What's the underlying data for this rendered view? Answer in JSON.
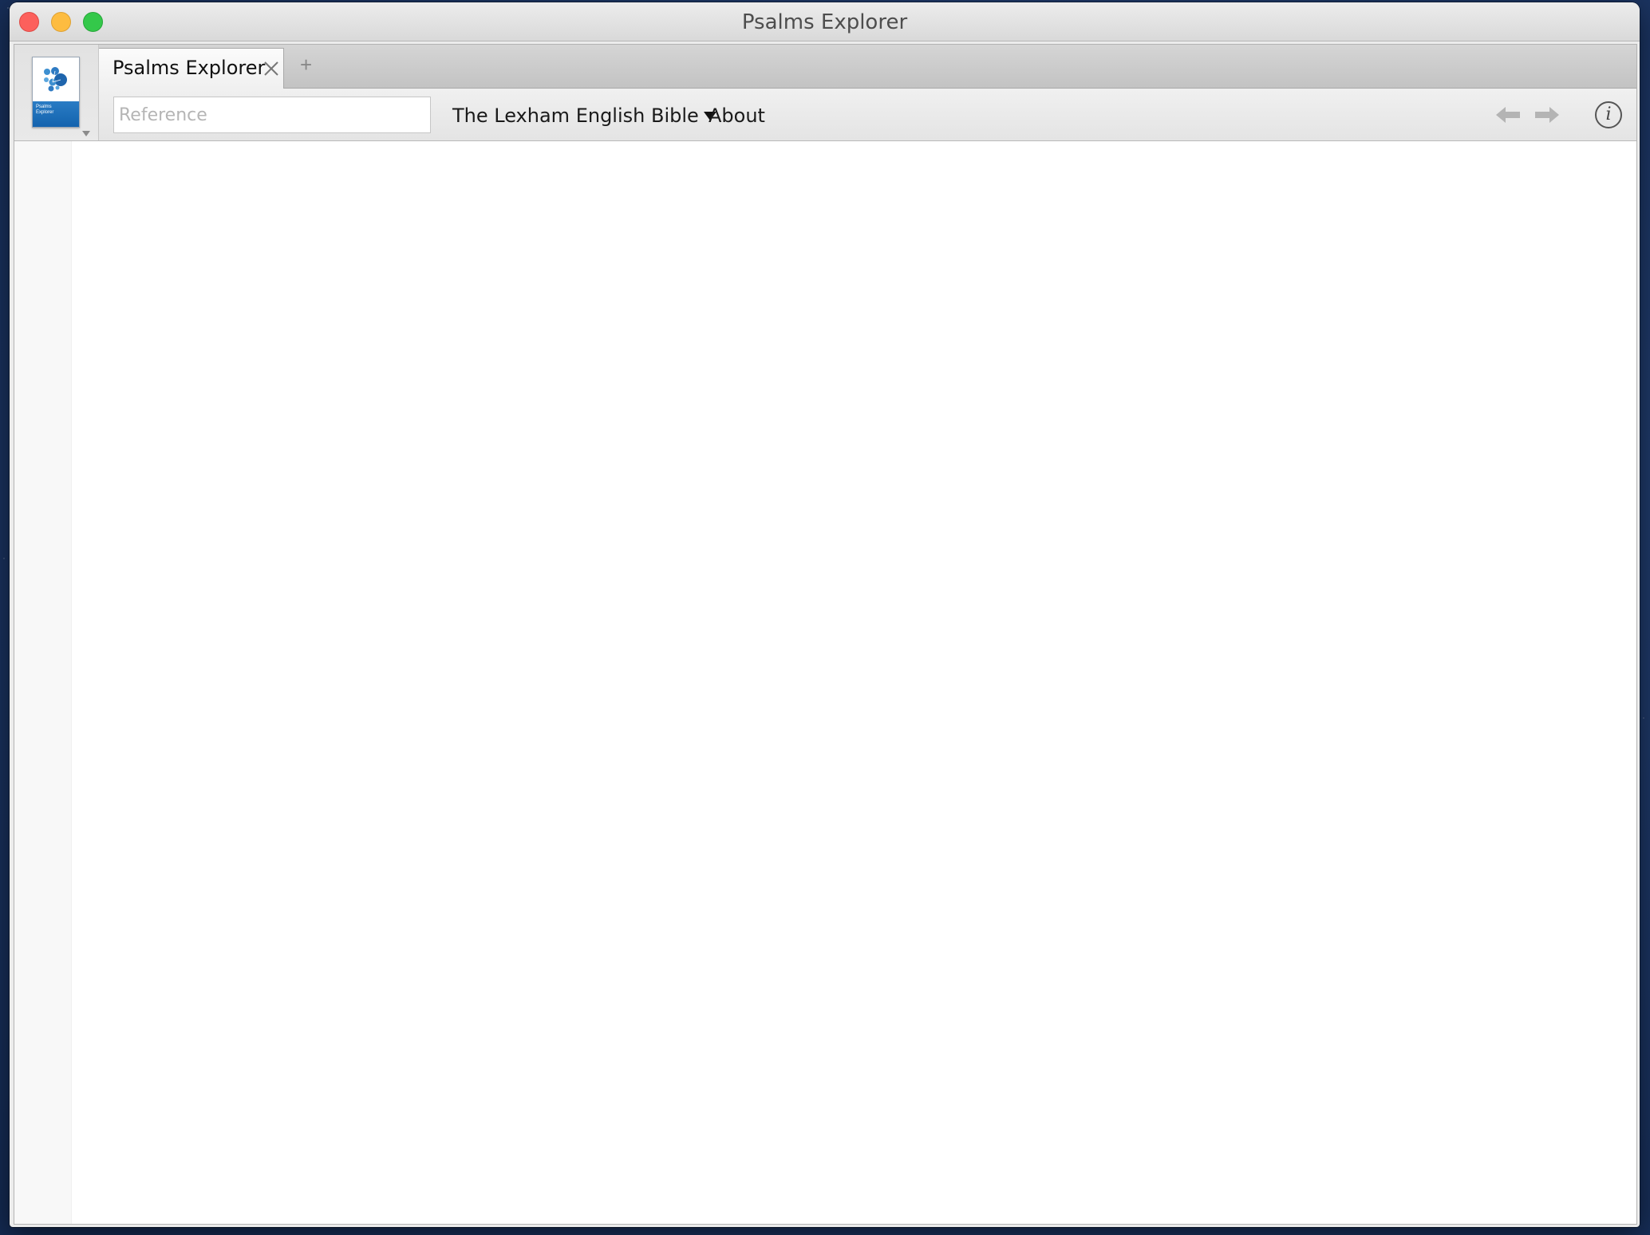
{
  "window": {
    "title": "Psalms Explorer"
  },
  "colors": {
    "close": "#fc605c",
    "minimize": "#fdbc40",
    "zoom": "#34c84a",
    "logo_blue": "#1363ae"
  },
  "tabs": [
    {
      "label": "Psalms Explorer",
      "active": true
    }
  ],
  "toolbar": {
    "reference_placeholder": "Reference",
    "reference_value": "",
    "bible_version": "The Lexham English Bible",
    "about_label": "About"
  },
  "icons": {
    "logo": "psalms-explorer-logo",
    "tab_close": "close-x-icon",
    "new_tab": "plus-icon",
    "back": "arrow-left-icon",
    "forward": "arrow-right-icon",
    "info": "info-icon"
  },
  "logo": {
    "line1": "Psalms",
    "line2": "Explorer"
  },
  "glyphs": {
    "new_tab": "+",
    "info": "i"
  }
}
